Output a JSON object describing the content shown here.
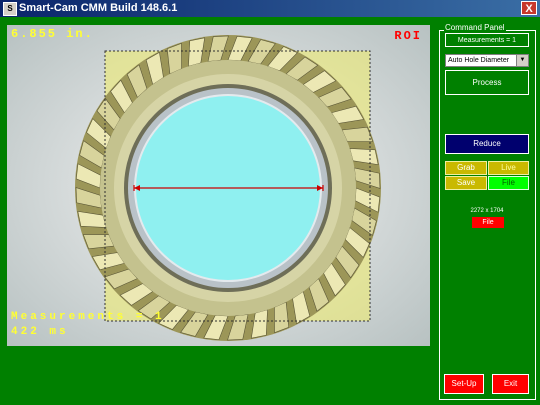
{
  "window": {
    "title": "Smart-Cam CMM Build 148.6.1",
    "close_glyph": "X",
    "app_icon_glyph": "S"
  },
  "overlay": {
    "distance": "6.855 in.",
    "roi": "ROI",
    "measurements": "Measurements = 1",
    "time": "422 ms"
  },
  "panel": {
    "legend": "Command Panel",
    "measurements": "Measurements = 1",
    "mode_select": "Auto Hole Diameter",
    "process_label": "Process",
    "reduce_label": "Reduce",
    "grab_label": "Grab",
    "live_label": "Live",
    "save_label": "Save",
    "file_label": "File",
    "resolution": "2272 x 1704",
    "file_red_label": "File",
    "setup_label": "Set-Up",
    "exit_label": "Exit"
  },
  "colors": {
    "background": "#008000",
    "overlay_text": "#ffff33",
    "roi_text": "#ff0000",
    "hole_fill": "#8ff0f0",
    "measure_line": "#cc0000",
    "reduce_button": "#00006e",
    "grab_buttons": "#c9b900",
    "file_button": "#00ff00",
    "exit_buttons": "#ff0000"
  }
}
